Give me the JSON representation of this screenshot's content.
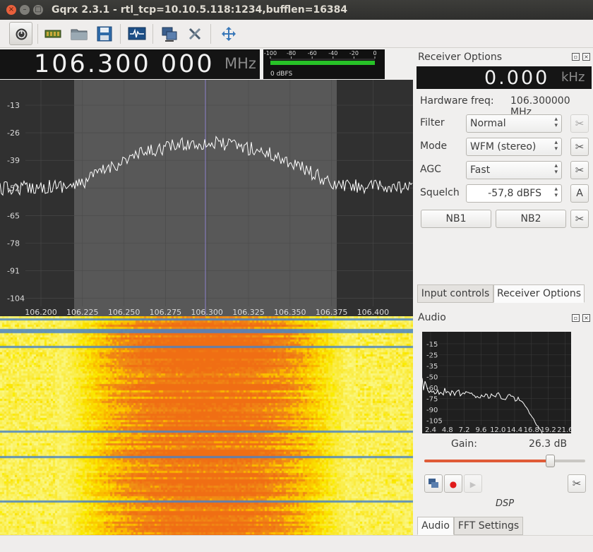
{
  "window": {
    "title": "Gqrx 2.3.1 - rtl_tcp=10.10.5.118:1234,bufflen=16384",
    "close_glyph": "×",
    "min_glyph": "–",
    "max_glyph": "□"
  },
  "toolbar": {
    "buttons": [
      {
        "name": "power-icon"
      },
      {
        "name": "io-devices-icon"
      },
      {
        "name": "open-folder-icon"
      },
      {
        "name": "save-icon"
      },
      {
        "name": "waveform-icon"
      },
      {
        "name": "remote-control-icon"
      },
      {
        "name": "configure-tools-icon"
      },
      {
        "name": "full-screen-icon"
      }
    ]
  },
  "frequency_display": {
    "value": "106.300 000",
    "unit": "MHz"
  },
  "signal_meter": {
    "ticks": [
      "-100",
      "-80",
      "-60",
      "-40",
      "-20",
      "0"
    ],
    "readout": "0 dBFS",
    "level_fraction": 1.0,
    "bar_color": "#27c227"
  },
  "spectrum": {
    "y_ticks": [
      "-13",
      "-26",
      "-39",
      "-52",
      "-65",
      "-78",
      "-91",
      "-104"
    ],
    "x_ticks": [
      "106.200",
      "106.225",
      "106.250",
      "106.275",
      "106.300",
      "106.325",
      "106.350",
      "106.375",
      "106.400"
    ],
    "background": "#303030",
    "passband_color": "#585858",
    "trace_color": "#ffffff",
    "center_line_color": "#8a80c8"
  },
  "receiver_options": {
    "title": "Receiver Options",
    "offset_value": "0.000",
    "offset_unit": "kHz",
    "hardware_freq_label": "Hardware freq:",
    "hardware_freq_value": "106.300000 MHz",
    "filter_label": "Filter",
    "filter_value": "Normal",
    "mode_label": "Mode",
    "mode_value": "WFM (stereo)",
    "agc_label": "AGC",
    "agc_value": "Fast",
    "squelch_label": "Squelch",
    "squelch_value": "-57,8 dBFS",
    "squelch_auto": "A",
    "nb1": "NB1",
    "nb2": "NB2",
    "tabs": [
      "Input controls",
      "Receiver Options"
    ],
    "active_tab": 1
  },
  "audio": {
    "title": "Audio",
    "y_ticks": [
      "-15",
      "-25",
      "-35",
      "-50",
      "-60",
      "-75",
      "-90",
      "-105"
    ],
    "x_ticks": [
      "2.4",
      "4.8",
      "7.2",
      "9.6",
      "12.0",
      "14.4",
      "16.8",
      "19.2",
      "21.6"
    ],
    "gain_label": "Gain:",
    "gain_value": "26.3 dB",
    "gain_fraction": 0.78,
    "dsp_label": "DSP",
    "tabs": [
      "Audio",
      "FFT Settings"
    ],
    "active_tab": 0
  }
}
